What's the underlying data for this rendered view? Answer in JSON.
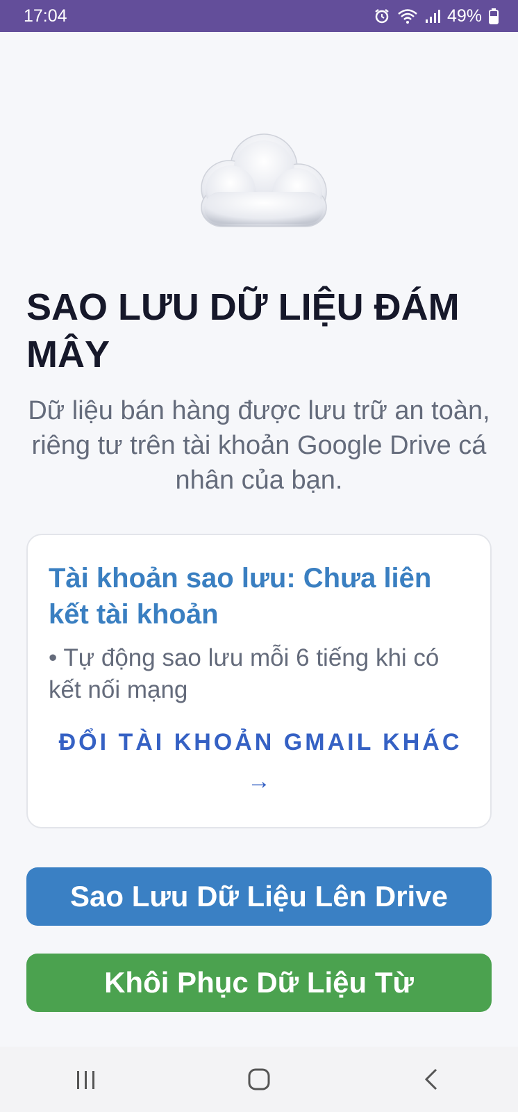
{
  "status_bar": {
    "time": "17:04",
    "battery": "49%",
    "icons": [
      "alarm-icon",
      "wifi-icon",
      "signal-icon",
      "battery-icon"
    ],
    "background": "#634e9a"
  },
  "header": {
    "illustration": "cloud-icon",
    "title": "SAO LƯU DỮ LIỆU ĐÁM MÂY",
    "subtitle": "Dữ liệu bán hàng được lưu trữ an toàn, riêng tư trên tài khoản Google Drive cá nhân của bạn."
  },
  "account_card": {
    "title": "Tài khoản sao lưu: Chưa liên kết tài khoản",
    "note": "• Tự động sao lưu mỗi 6 tiếng khi có kết nối mạng",
    "change_link": "ĐỔI TÀI KHOẢN GMAIL KHÁC →"
  },
  "actions": {
    "backup_label": "Sao Lưu Dữ Liệu Lên Drive",
    "restore_label": "Khôi Phục Dữ Liệu Từ"
  },
  "colors": {
    "accent_blue": "#3a80c4",
    "accent_green": "#4ba24f",
    "link_blue": "#3561c4",
    "title_dark": "#16182a"
  },
  "nav_bar": {
    "icons": [
      "recent-apps-icon",
      "home-icon",
      "back-icon"
    ]
  }
}
